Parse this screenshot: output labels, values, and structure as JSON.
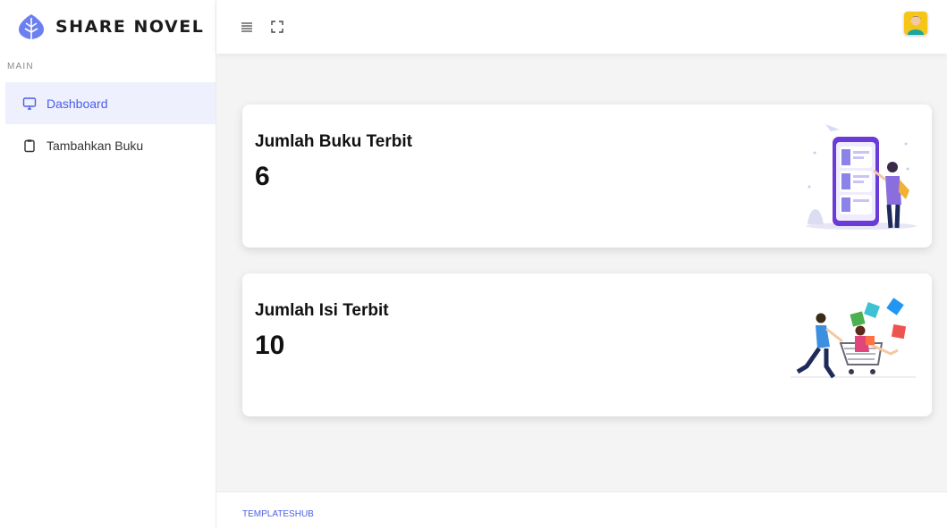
{
  "brand": {
    "name": "SHARE NOVEL"
  },
  "sidebar": {
    "section_label": "MAIN",
    "items": [
      {
        "label": "Dashboard",
        "icon": "monitor-icon",
        "active": true
      },
      {
        "label": "Tambahkan Buku",
        "icon": "clipboard-icon",
        "active": false
      }
    ]
  },
  "topbar": {
    "menu_icon": "hamburger-menu-icon",
    "fullscreen_icon": "fullscreen-icon",
    "avatar_icon": "user-avatar-icon"
  },
  "cards": [
    {
      "title": "Jumlah Buku Terbit",
      "value": "6",
      "illustration": "phone-books-illustration"
    },
    {
      "title": "Jumlah Isi Terbit",
      "value": "10",
      "illustration": "shopping-cart-illustration"
    }
  ],
  "footer": {
    "text": "TEMPLATESHUB"
  },
  "colors": {
    "accent": "#4a5ee8",
    "active_bg": "#eef0fd",
    "page_bg": "#f4f4f4",
    "avatar_bg": "#f5c518"
  }
}
